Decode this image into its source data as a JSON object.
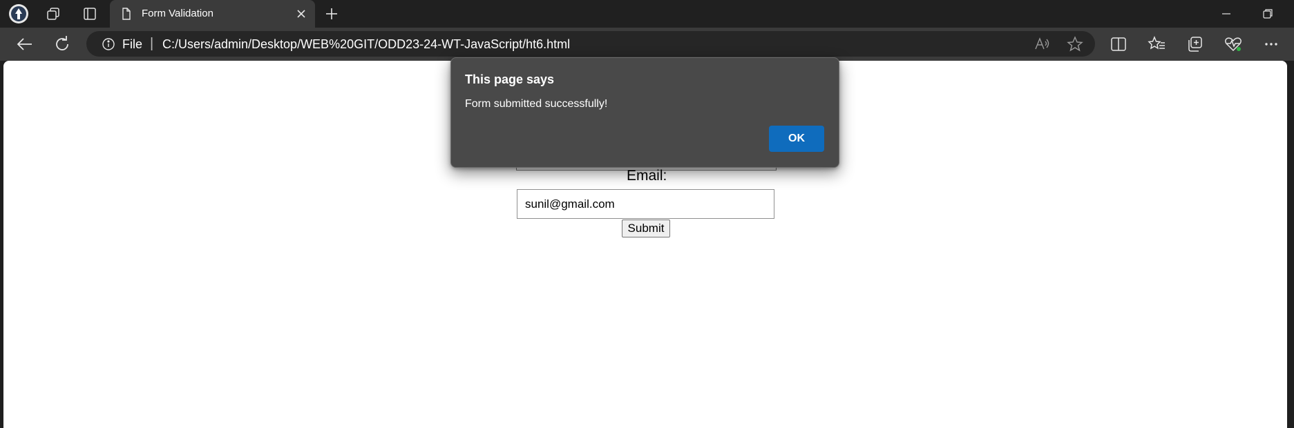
{
  "browser": {
    "tab": {
      "title": "Form Validation"
    },
    "address": {
      "scheme": "File",
      "separator": "|",
      "url": "C:/Users/admin/Desktop/WEB%20GIT/ODD23-24-WT-JavaScript/ht6.html"
    },
    "icons": {
      "profile": "profile-avatar-icon",
      "workspaces": "workspaces-icon",
      "tab_actions": "vertical-tabs-icon",
      "page": "page-icon",
      "close": "close-icon",
      "new_tab": "plus-icon",
      "minimize": "minimize-icon",
      "restore": "restore-icon",
      "back": "back-arrow-icon",
      "refresh": "refresh-icon",
      "info": "info-icon",
      "read_aloud": "read-aloud-icon",
      "favorite": "star-icon",
      "split_screen": "split-screen-icon",
      "favorites": "favorites-icon",
      "collections": "collections-icon",
      "performance": "heartbeat-icon",
      "more": "ellipsis-icon"
    },
    "colors": {
      "chrome_dark": "#202020",
      "toolbar": "#3b3b3b",
      "address_bg": "#262626"
    }
  },
  "page": {
    "form": {
      "email_label": "Email:",
      "email_value": "sunil@gmail.com",
      "submit_label": "Submit"
    }
  },
  "dialog": {
    "title": "This page says",
    "message": "Form submitted successfully!",
    "ok_label": "OK",
    "colors": {
      "background": "#494949",
      "ok_button": "#0f6cbd"
    }
  }
}
